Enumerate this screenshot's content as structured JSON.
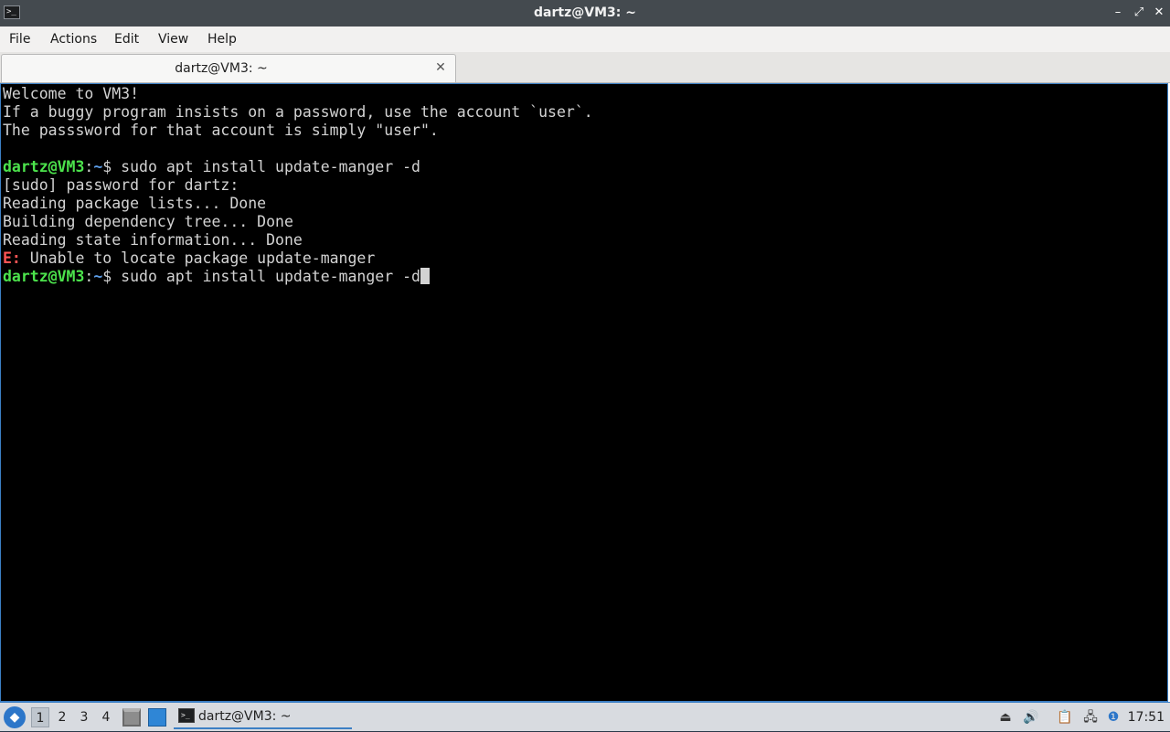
{
  "window": {
    "title": "dartz@VM3: ~",
    "app_icon": "terminal-icon",
    "controls": {
      "minimize": "–",
      "maximize": "⤢",
      "close": "✕"
    }
  },
  "menubar": {
    "items": [
      "File",
      "Actions",
      "Edit",
      "View",
      "Help"
    ]
  },
  "tabs": [
    {
      "label": "dartz@VM3: ~",
      "close": "✕"
    }
  ],
  "terminal": {
    "welcome": [
      "Welcome to VM3!",
      "If a buggy program insists on a password, use the account `user`.",
      "The passsword for that account is simply \"user\"."
    ],
    "prompt": {
      "user": "dartz@VM3",
      "sep": ":",
      "path": "~",
      "symbol": "$"
    },
    "command1": " sudo apt install update-manger -d",
    "output": [
      "[sudo] password for dartz:",
      "Reading package lists... Done",
      "Building dependency tree... Done",
      "Reading state information... Done"
    ],
    "error_label": "E:",
    "error_text": " Unable to locate package update-manger",
    "command2": " sudo apt install update-manger -d"
  },
  "taskbar": {
    "start_icon": "lxqt-start-icon",
    "workspaces": [
      "1",
      "2",
      "3",
      "4"
    ],
    "active_workspace": "1",
    "quicklaunch": [
      "file-manager-icon",
      "show-desktop-icon"
    ],
    "task": {
      "label": "dartz@VM3: ~",
      "icon": "terminal-icon"
    },
    "tray": [
      "removable-media-icon",
      "volume-icon",
      "clipboard-icon",
      "network-icon",
      "update-notifier-icon"
    ],
    "clock": "17:51"
  },
  "colors": {
    "titlebar": "#444a4f",
    "terminal_bg": "#000000",
    "prompt_user": "#4ce34c",
    "prompt_path": "#5c9de8",
    "error": "#ff5555",
    "accent": "#3c7fc4"
  }
}
